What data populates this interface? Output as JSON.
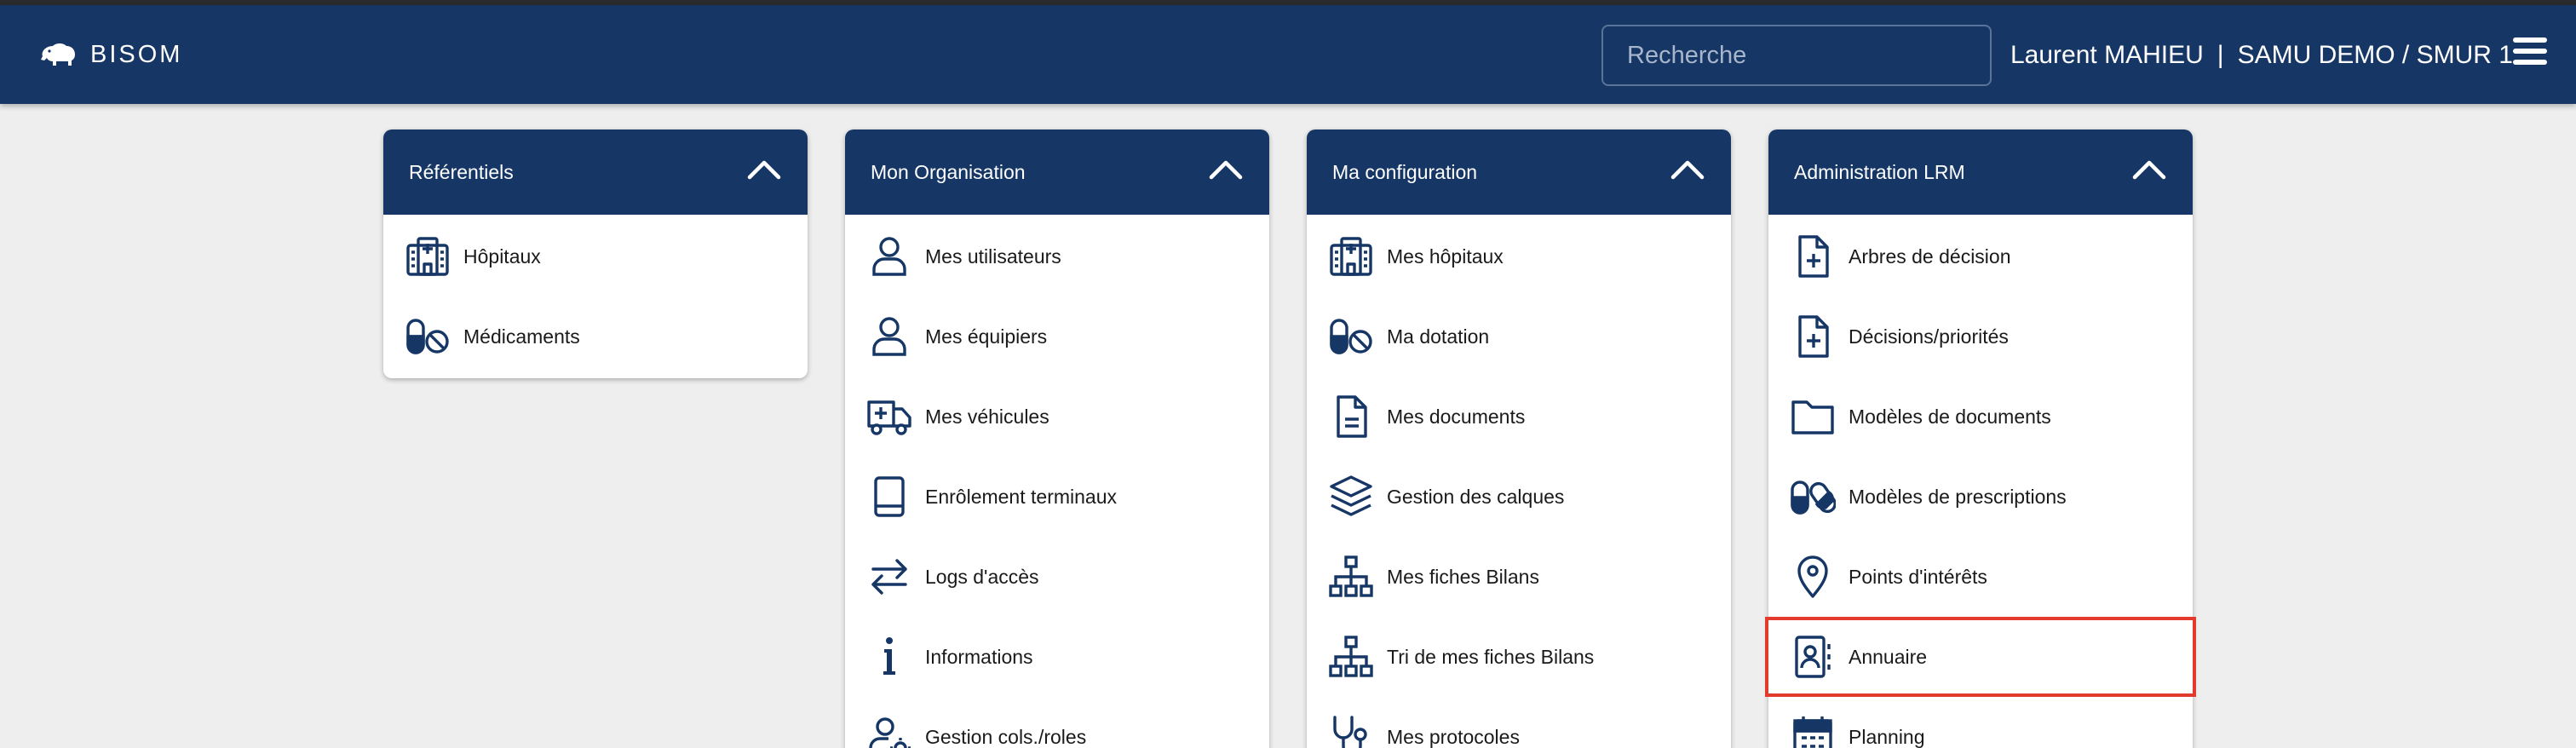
{
  "app": {
    "brand": "BISOM"
  },
  "search": {
    "placeholder": "Recherche"
  },
  "user": {
    "name": "Laurent MAHIEU",
    "separator": "|",
    "context": "SAMU DEMO / SMUR 1"
  },
  "colors": {
    "navy": "#163766",
    "highlight": "#e23a2c",
    "background": "#eeeeee"
  },
  "cards": [
    {
      "title": "Référentiels",
      "items": [
        {
          "label": "Hôpitaux",
          "icon": "hospital-icon"
        },
        {
          "label": "Médicaments",
          "icon": "pill-ban-icon"
        }
      ]
    },
    {
      "title": "Mon Organisation",
      "items": [
        {
          "label": "Mes utilisateurs",
          "icon": "user-icon"
        },
        {
          "label": "Mes équipiers",
          "icon": "user-icon"
        },
        {
          "label": "Mes véhicules",
          "icon": "ambulance-icon"
        },
        {
          "label": "Enrôlement terminaux",
          "icon": "tablet-icon"
        },
        {
          "label": "Logs d'accès",
          "icon": "arrows-exchange-icon"
        },
        {
          "label": "Informations",
          "icon": "info-icon"
        },
        {
          "label": "Gestion cols./roles",
          "icon": "user-gear-icon"
        }
      ]
    },
    {
      "title": "Ma configuration",
      "items": [
        {
          "label": "Mes hôpitaux",
          "icon": "hospital-icon"
        },
        {
          "label": "Ma dotation",
          "icon": "pill-ban-icon"
        },
        {
          "label": "Mes documents",
          "icon": "document-icon"
        },
        {
          "label": "Gestion des calques",
          "icon": "layers-icon"
        },
        {
          "label": "Mes fiches Bilans",
          "icon": "sitemap-icon"
        },
        {
          "label": "Tri de mes fiches Bilans",
          "icon": "sitemap-icon"
        },
        {
          "label": "Mes protocoles",
          "icon": "stethoscope-icon"
        }
      ]
    },
    {
      "title": "Administration LRM",
      "items": [
        {
          "label": "Arbres de décision",
          "icon": "file-plus-icon"
        },
        {
          "label": "Décisions/priorités",
          "icon": "file-plus-icon"
        },
        {
          "label": "Modèles de documents",
          "icon": "folder-icon"
        },
        {
          "label": "Modèles de prescriptions",
          "icon": "pills-icon"
        },
        {
          "label": "Points d'intérêts",
          "icon": "map-pin-icon"
        },
        {
          "label": "Annuaire",
          "icon": "address-book-icon",
          "highlighted": true
        },
        {
          "label": "Planning",
          "icon": "calendar-icon"
        }
      ]
    }
  ]
}
